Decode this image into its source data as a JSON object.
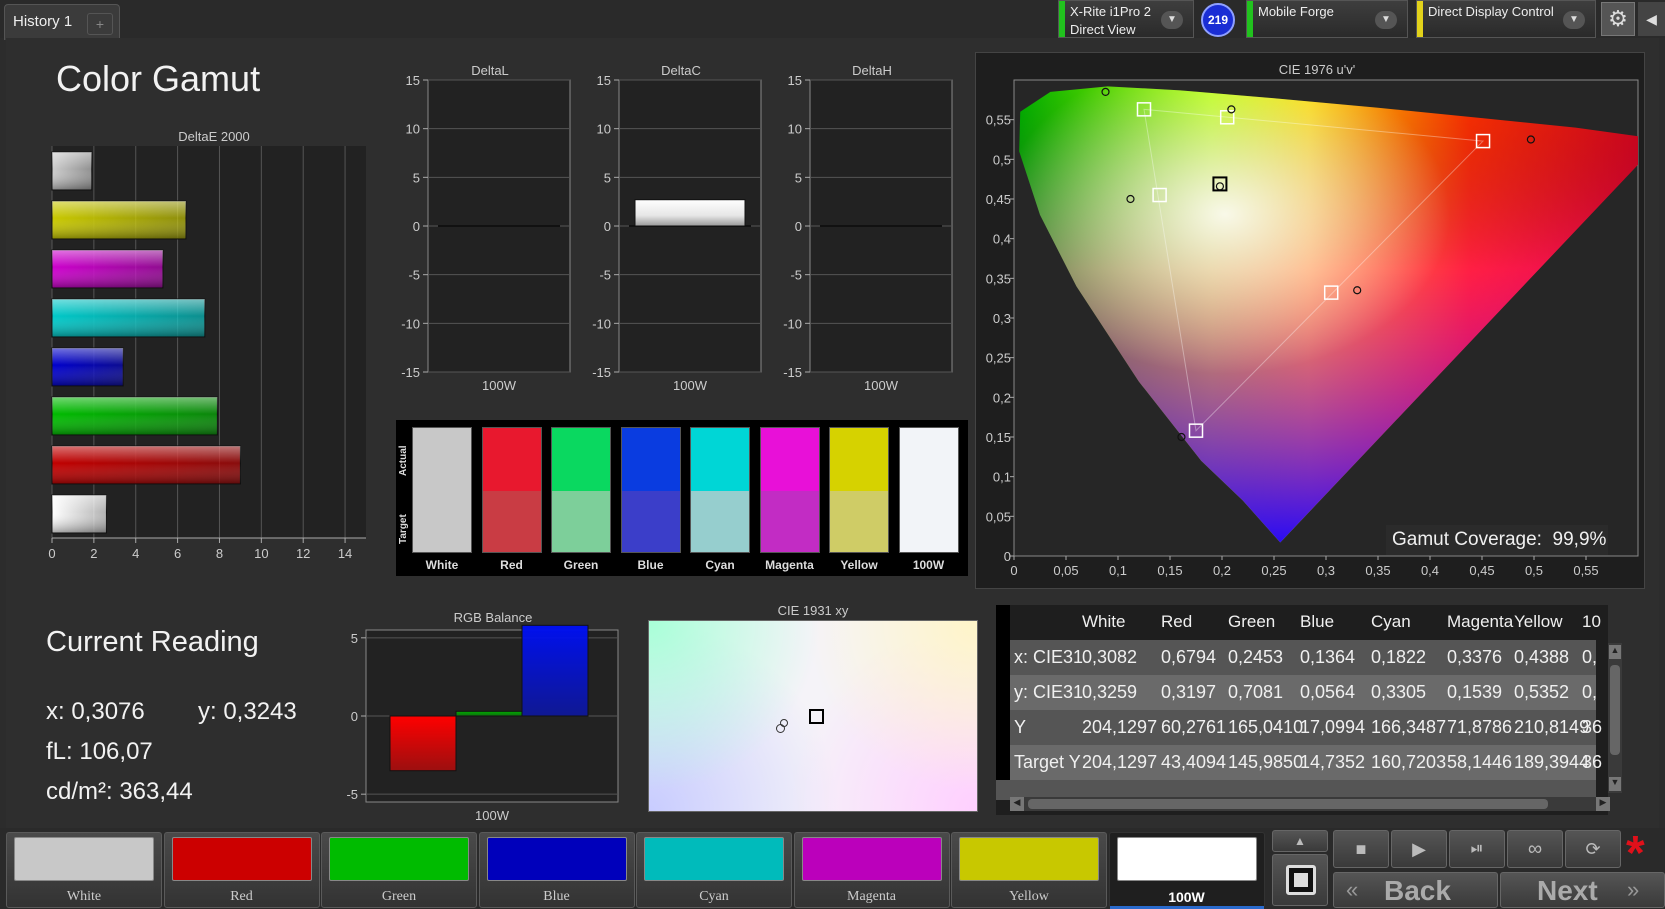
{
  "tabs": {
    "active_label": "History 1",
    "add_label": "+"
  },
  "header": {
    "meter_line1": "X-Rite i1Pro 2",
    "meter_line2": "Direct View",
    "badge": "219",
    "profile": "Mobile Forge",
    "control": "Direct Display Control",
    "settings_icon": "gear-icon",
    "arrow_icon": "chevron-down-icon"
  },
  "page": {
    "title": "Color Gamut"
  },
  "deltae_chart": {
    "title": "DeltaE 2000",
    "x_ticks": [
      "0",
      "2",
      "4",
      "6",
      "8",
      "10",
      "12",
      "14"
    ]
  },
  "deltaL": {
    "title": "DeltaL",
    "xlabel": "100W"
  },
  "deltaC": {
    "title": "DeltaC",
    "xlabel": "100W"
  },
  "deltaH": {
    "title": "DeltaH",
    "xlabel": "100W"
  },
  "delta_ticks": [
    "15",
    "10",
    "5",
    "0",
    "-5",
    "-10",
    "-15"
  ],
  "swatches": {
    "actual_label": "Actual",
    "target_label": "Target",
    "items": [
      {
        "label": "White",
        "actual": "#c8c8c8",
        "target": "#c8c8c8"
      },
      {
        "label": "Red",
        "actual": "#e8182e",
        "target": "#c93c44"
      },
      {
        "label": "Green",
        "actual": "#0ad860",
        "target": "#7dcf9a"
      },
      {
        "label": "Blue",
        "actual": "#0a3ce0",
        "target": "#3b3ec9"
      },
      {
        "label": "Cyan",
        "actual": "#00d6d6",
        "target": "#96cece"
      },
      {
        "label": "Magenta",
        "actual": "#e810d8",
        "target": "#c22cc4"
      },
      {
        "label": "Yellow",
        "actual": "#d6d200",
        "target": "#cfcc66"
      },
      {
        "label": "100W",
        "actual": "#f2f4f8",
        "target": "#f2f4f8"
      }
    ]
  },
  "cie1976": {
    "title": "CIE 1976 u'v'",
    "x_ticks": [
      "0",
      "0,05",
      "0,1",
      "0,15",
      "0,2",
      "0,25",
      "0,3",
      "0,35",
      "0,4",
      "0,45",
      "0,5",
      "0,55"
    ],
    "y_ticks": [
      "0",
      "0,05",
      "0,1",
      "0,15",
      "0,2",
      "0,25",
      "0,3",
      "0,35",
      "0,4",
      "0,45",
      "0,5",
      "0,55"
    ],
    "coverage_label": "Gamut Coverage:",
    "coverage_value": "99,9%"
  },
  "current_reading": {
    "title": "Current Reading",
    "x": "x: 0,3076",
    "y": "y: 0,3243",
    "fl": "fL: 106,07",
    "cdm2": "cd/m²: 363,44"
  },
  "rgb_balance": {
    "title": "RGB Balance",
    "xlabel": "100W",
    "y_ticks": [
      "5",
      "0",
      "-5"
    ]
  },
  "cie1931": {
    "title": "CIE 1931 xy"
  },
  "table": {
    "columns": [
      "",
      "White",
      "Red",
      "Green",
      "Blue",
      "Cyan",
      "Magenta",
      "Yellow",
      "10"
    ],
    "rows": [
      [
        "x: CIE31",
        "0,3082",
        "0,6794",
        "0,2453",
        "0,1364",
        "0,1822",
        "0,3376",
        "0,4388",
        "0,"
      ],
      [
        "y: CIE31",
        "0,3259",
        "0,3197",
        "0,7081",
        "0,0564",
        "0,3305",
        "0,1539",
        "0,5352",
        "0,"
      ],
      [
        "Y",
        "204,1297",
        "60,2761",
        "165,0410",
        "17,0994",
        "166,3487",
        "71,8786",
        "210,8149",
        "36"
      ],
      [
        "Target Y",
        "204,1297",
        "43,4094",
        "145,9850",
        "14,7352",
        "160,7203",
        "58,1446",
        "189,3944",
        "36"
      ]
    ]
  },
  "patches": [
    {
      "label": "White",
      "color": "#c8c8c8"
    },
    {
      "label": "Red",
      "color": "#cc0000"
    },
    {
      "label": "Green",
      "color": "#00bb00"
    },
    {
      "label": "Blue",
      "color": "#0000bb"
    },
    {
      "label": "Cyan",
      "color": "#00bbbb"
    },
    {
      "label": "Magenta",
      "color": "#bb00bb"
    },
    {
      "label": "Yellow",
      "color": "#c8c800"
    },
    {
      "label": "100W",
      "color": "#ffffff"
    }
  ],
  "nav": {
    "back": "Back",
    "next": "Next"
  },
  "chart_data": [
    {
      "type": "bar",
      "title": "DeltaE 2000",
      "orientation": "horizontal",
      "categories": [
        "100W",
        "Yellow",
        "Magenta",
        "Cyan",
        "Blue",
        "Green",
        "Red",
        "White"
      ],
      "values": [
        2.6,
        6.4,
        5.3,
        7.3,
        3.4,
        7.9,
        9.0,
        1.9
      ],
      "colors": [
        "#ffffff",
        "#c8c800",
        "#cc00cc",
        "#00c8c8",
        "#0000cc",
        "#00bb00",
        "#c00000",
        "#cccccc"
      ],
      "xlim": [
        0,
        15
      ]
    },
    {
      "type": "bar",
      "title": "DeltaL",
      "categories": [
        "100W"
      ],
      "values": [
        0
      ],
      "ylim": [
        -15,
        15
      ]
    },
    {
      "type": "bar",
      "title": "DeltaC",
      "categories": [
        "100W"
      ],
      "values": [
        2.7
      ],
      "ylim": [
        -15,
        15
      ]
    },
    {
      "type": "bar",
      "title": "DeltaH",
      "categories": [
        "100W"
      ],
      "values": [
        0
      ],
      "ylim": [
        -15,
        15
      ]
    },
    {
      "type": "bar",
      "title": "RGB Balance",
      "categories": [
        "R",
        "G",
        "B"
      ],
      "values": [
        -3.5,
        0.3,
        5.8
      ],
      "ylim": [
        -5.5,
        5.5
      ]
    },
    {
      "type": "scatter",
      "title": "CIE 1976 u'v'",
      "xlim": [
        0,
        0.6
      ],
      "ylim": [
        0,
        0.6
      ],
      "series": [
        {
          "name": "Target",
          "points": [
            [
              0.451,
              0.523
            ],
            [
              0.125,
              0.563
            ],
            [
              0.175,
              0.158
            ],
            [
              0.14,
              0.455
            ],
            [
              0.305,
              0.332
            ],
            [
              0.205,
              0.553
            ],
            [
              0.198,
              0.469
            ]
          ]
        },
        {
          "name": "Actual",
          "points": [
            [
              0.497,
              0.525
            ],
            [
              0.088,
              0.585
            ],
            [
              0.161,
              0.15
            ],
            [
              0.112,
              0.45
            ],
            [
              0.33,
              0.335
            ],
            [
              0.209,
              0.563
            ],
            [
              0.198,
              0.466
            ]
          ]
        }
      ]
    }
  ]
}
